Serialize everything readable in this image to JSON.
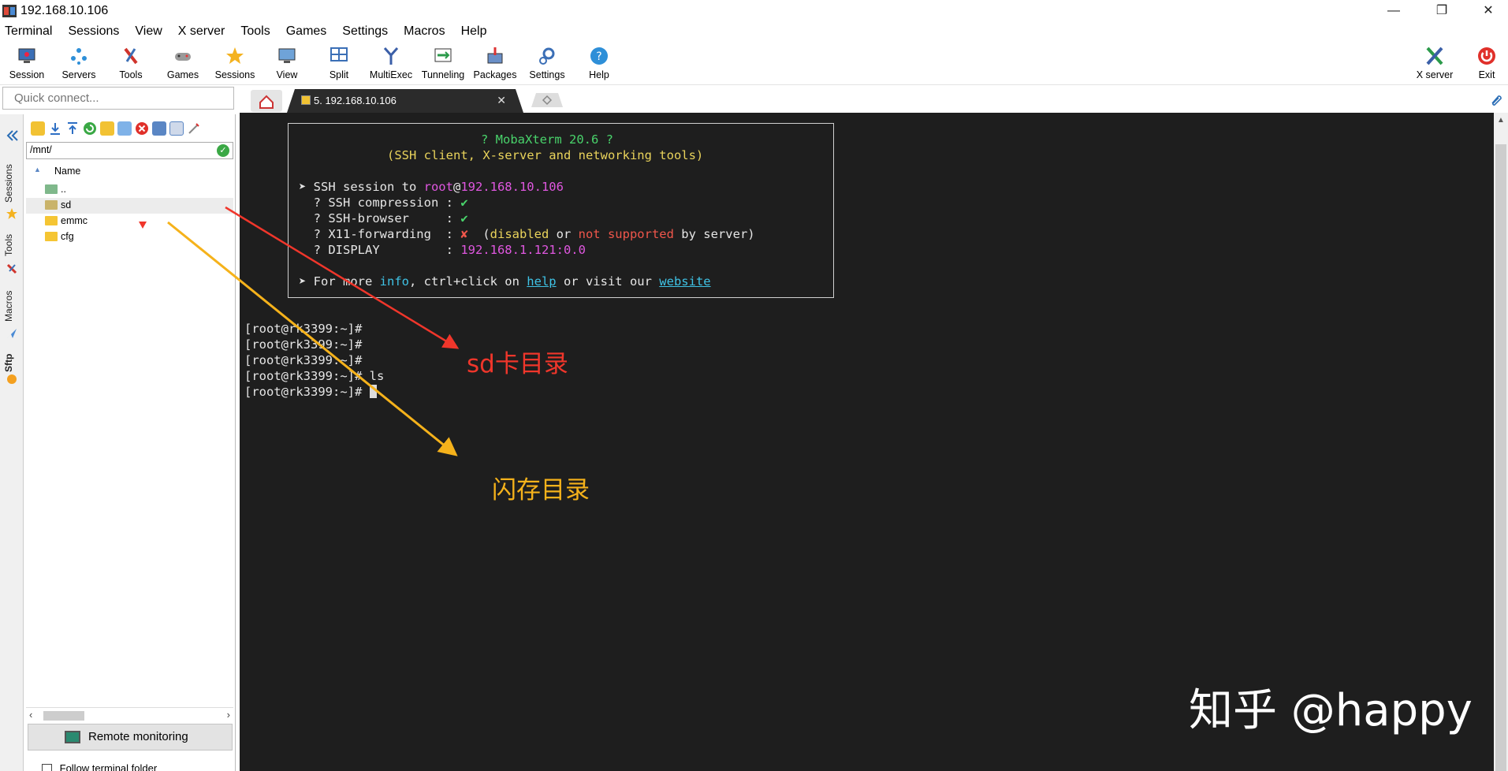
{
  "window": {
    "title": "192.168.10.106",
    "minimize": "—",
    "restore": "❐",
    "close": "✕"
  },
  "menu": [
    "Terminal",
    "Sessions",
    "View",
    "X server",
    "Tools",
    "Games",
    "Settings",
    "Macros",
    "Help"
  ],
  "toolbar": {
    "items": [
      "Session",
      "Servers",
      "Tools",
      "Games",
      "Sessions",
      "View",
      "Split",
      "MultiExec",
      "Tunneling",
      "Packages",
      "Settings",
      "Help"
    ],
    "right_items": [
      "X server",
      "Exit"
    ]
  },
  "quick_connect": {
    "placeholder": "Quick connect..."
  },
  "tabs": {
    "active": "5. 192.168.10.106",
    "close": "✕"
  },
  "side_tabs": [
    "Sessions",
    "Tools",
    "Macros",
    "Sftp"
  ],
  "sftp": {
    "path": "/mnt/",
    "column": "Name",
    "files": [
      "..",
      "sd",
      "emmc",
      "cfg"
    ],
    "selected": "sd",
    "remote_monitoring": "Remote monitoring",
    "follow_folder": "Follow terminal folder"
  },
  "terminal": {
    "banner_title": "? MobaXterm 20.6 ?",
    "banner_subtitle": "(SSH client, X-server and networking tools)",
    "session_prefix": "➤ SSH session to ",
    "session_user": "root",
    "session_at": "@",
    "session_host": "192.168.10.106",
    "compression_label": "  ? SSH compression : ",
    "compression_value": "✔",
    "browser_label": "  ? SSH-browser     : ",
    "browser_value": "✔",
    "x11_label": "  ? X11-forwarding  : ",
    "x11_value": "✘",
    "x11_open": "  (",
    "x11_disabled": "disabled",
    "x11_or": " or ",
    "x11_not_supported": "not supported",
    "x11_tail": " by server)",
    "display_label": "  ? DISPLAY         : ",
    "display_value": "192.168.1.121:0.0",
    "more_prefix": "➤ For more ",
    "more_info": "info",
    "more_mid": ", ctrl+click on ",
    "more_help": "help",
    "more_visit": " or visit our ",
    "more_website": "website",
    "prompts": [
      "[root@rk3399:~]#",
      "[root@rk3399:~]#",
      "[root@rk3399:~]#",
      "[root@rk3399:~]# ls",
      "[root@rk3399:~]#"
    ]
  },
  "annotations": {
    "sd_label": "sd卡目录",
    "flash_label": "闪存目录",
    "watermark": "知乎 @happy"
  },
  "colors": {
    "terminal_bg": "#1e1e1e",
    "arrow_red": "#f0362b",
    "arrow_yellow": "#f5b21b"
  }
}
